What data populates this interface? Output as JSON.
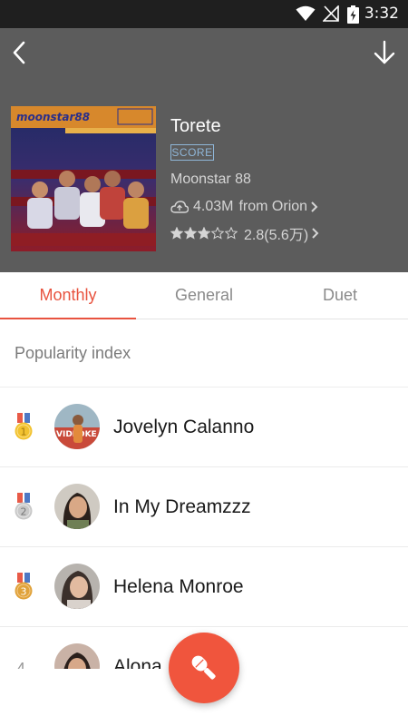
{
  "status_bar": {
    "time": "3:32"
  },
  "song": {
    "title": "Torete",
    "badge": "SCORE",
    "artist": "Moonstar 88",
    "plays": "4.03M",
    "source": "from Orion",
    "rating_value": 2.8,
    "rating_text": "2.8(5.6万)",
    "cover_logo": "moonstar88"
  },
  "tabs": [
    {
      "label": "Monthly",
      "active": true
    },
    {
      "label": "General",
      "active": false
    },
    {
      "label": "Duet",
      "active": false
    }
  ],
  "section_title": "Popularity index",
  "leaderboard": [
    {
      "rank": "1",
      "name": "Jovelyn Calanno",
      "medal": "gold"
    },
    {
      "rank": "2",
      "name": "In My Dreamzzz",
      "medal": "silver"
    },
    {
      "rank": "3",
      "name": "Helena Monroe",
      "medal": "bronze"
    },
    {
      "rank": "4",
      "name": "Alona",
      "medal": "none"
    }
  ],
  "colors": {
    "accent": "#e8533f",
    "header_bg": "#5c5c5c",
    "gold": "#f2c230",
    "silver": "#c8c8c8",
    "bronze": "#e0a23a"
  },
  "icons": {
    "back": "chevron-left-icon",
    "download": "download-arrow-icon",
    "record": "microphone-icon"
  }
}
